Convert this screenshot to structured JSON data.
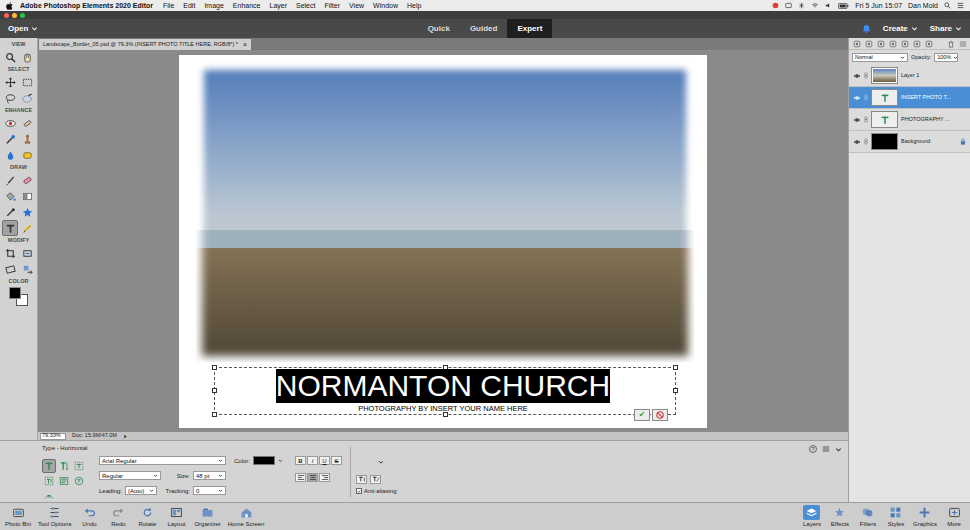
{
  "menubar": {
    "app": "Adobe Photoshop Elements 2020 Editor",
    "items": [
      "File",
      "Edit",
      "Image",
      "Enhance",
      "Layer",
      "Select",
      "Filter",
      "View",
      "Window",
      "Help"
    ],
    "clock": "Fri 5 Jun 15:07",
    "user": "Dan Mold"
  },
  "topbar": {
    "open": "Open",
    "modes": [
      {
        "label": "Quick",
        "selected": false
      },
      {
        "label": "Guided",
        "selected": false
      },
      {
        "label": "Expert",
        "selected": true
      }
    ],
    "create": "Create",
    "share": "Share"
  },
  "toolbox": {
    "sections": [
      {
        "label": "VIEW",
        "tools": [
          {
            "kind": "zoom",
            "selected": false
          },
          {
            "kind": "hand",
            "selected": false
          }
        ]
      },
      {
        "label": "SELECT",
        "tools": [
          {
            "kind": "move",
            "selected": false
          },
          {
            "kind": "marquee",
            "selected": false
          },
          {
            "kind": "lasso",
            "selected": false
          },
          {
            "kind": "quickselect",
            "selected": false
          }
        ]
      },
      {
        "label": "ENHANCE",
        "tools": [
          {
            "kind": "redeye",
            "selected": false
          },
          {
            "kind": "spotheal",
            "selected": false
          },
          {
            "kind": "smartbrush",
            "selected": false
          },
          {
            "kind": "clone",
            "selected": false
          },
          {
            "kind": "blur",
            "selected": false
          },
          {
            "kind": "sponge",
            "selected": false
          }
        ]
      },
      {
        "label": "DRAW",
        "tools": [
          {
            "kind": "brush",
            "selected": false
          },
          {
            "kind": "eraser",
            "selected": false
          },
          {
            "kind": "bucket",
            "selected": false
          },
          {
            "kind": "gradient",
            "selected": false
          },
          {
            "kind": "eyedropper",
            "selected": false
          },
          {
            "kind": "shape",
            "selected": false
          },
          {
            "kind": "type",
            "selected": true
          },
          {
            "kind": "pencil",
            "selected": false
          }
        ]
      },
      {
        "label": "MODIFY",
        "tools": [
          {
            "kind": "crop",
            "selected": false
          },
          {
            "kind": "recompose",
            "selected": false
          },
          {
            "kind": "straighten",
            "selected": false
          },
          {
            "kind": "contentmove",
            "selected": false
          }
        ]
      }
    ],
    "color": {
      "label": "COLOR",
      "foreground": "#000000",
      "background": "#ffffff"
    }
  },
  "document": {
    "tab": "Landscape_Border_05.psd @ 79.3% (INSERT PHOTO TITLE HERE, RGB/8*) *",
    "close": "×",
    "title": "NORMANTON CHURCH",
    "title_selected": true,
    "subtitle": "PHOTOGRAPHY BY INSERT YOUR NAME HERE",
    "commit": "✔"
  },
  "status": {
    "zoom": "79.33%",
    "doc": "Doc: 15.9M/47.0M"
  },
  "options": {
    "heading": "Type - Horizontal",
    "variants": [
      {
        "kind": "horizontal",
        "selected": true
      },
      {
        "kind": "vertical",
        "selected": false
      },
      {
        "kind": "hmask",
        "selected": false
      },
      {
        "kind": "vmask",
        "selected": false
      },
      {
        "kind": "textbox",
        "selected": false
      },
      {
        "kind": "shapetext",
        "selected": false
      },
      {
        "kind": "pathtext",
        "selected": false
      }
    ],
    "font": "Arial Regular",
    "style": "Regular",
    "size_label": "Size:",
    "size": "48 pt",
    "color_label": "Color:",
    "color": "#000000",
    "leading_label": "Leading:",
    "leading": "(Auto)",
    "tracking_label": "Tracking:",
    "tracking": "0",
    "format": [
      {
        "label": "B",
        "selected": false
      },
      {
        "label": "I",
        "selected": false
      },
      {
        "label": "U",
        "selected": false
      },
      {
        "label": "S",
        "selected": false
      }
    ],
    "align": [
      {
        "kind": "left",
        "selected": false
      },
      {
        "kind": "center",
        "selected": true
      },
      {
        "kind": "right",
        "selected": false
      }
    ],
    "anti_aliasing": {
      "label": "Anti-aliasing",
      "checked": true
    },
    "help": "?"
  },
  "layers_panel": {
    "blend": "Normal",
    "opacity_label": "Opacity:",
    "opacity": "100%",
    "layers": [
      {
        "name": "Layer 1",
        "kind": "photo",
        "visible": true,
        "locked": false,
        "selected": false
      },
      {
        "name": "INSERT PHOTO T...",
        "kind": "text",
        "visible": true,
        "locked": false,
        "selected": true
      },
      {
        "name": "PHOTOGRAPHY ...",
        "kind": "text",
        "visible": true,
        "locked": false,
        "selected": false
      },
      {
        "name": "Background",
        "kind": "fill",
        "visible": true,
        "locked": true,
        "selected": false
      }
    ]
  },
  "taskbar": {
    "left": [
      {
        "label": "Photo Bin",
        "kind": "bin",
        "selected": false
      },
      {
        "label": "Tool Options",
        "kind": "options",
        "selected": false
      },
      {
        "label": "Undo",
        "kind": "undo",
        "selected": false
      },
      {
        "label": "Redo",
        "kind": "redo",
        "selected": false
      },
      {
        "label": "Rotate",
        "kind": "rotate",
        "selected": false
      },
      {
        "label": "Layout",
        "kind": "layout",
        "selected": false
      },
      {
        "label": "Organizer",
        "kind": "organizer",
        "selected": false
      },
      {
        "label": "Home Screen",
        "kind": "home",
        "selected": false
      }
    ],
    "right": [
      {
        "label": "Layers",
        "kind": "layers",
        "selected": true
      },
      {
        "label": "Effects",
        "kind": "effects",
        "selected": false
      },
      {
        "label": "Filters",
        "kind": "filters",
        "selected": false
      },
      {
        "label": "Styles",
        "kind": "styles",
        "selected": false
      },
      {
        "label": "Graphics",
        "kind": "graphics",
        "selected": false
      },
      {
        "label": "More",
        "kind": "more",
        "selected": false
      }
    ]
  }
}
